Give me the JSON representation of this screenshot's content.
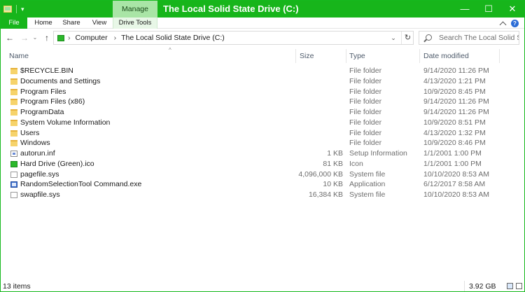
{
  "window": {
    "title": "The Local Solid State Drive (C:)",
    "contextual_tab": "Manage",
    "controls": {
      "minimize": "—",
      "maximize": "☐",
      "close": "✕"
    },
    "accent_color": "#17b51b"
  },
  "quick_access": {
    "separator": "|",
    "dropdown": "▾"
  },
  "ribbon": {
    "tabs": [
      {
        "label": "File"
      },
      {
        "label": "Home"
      },
      {
        "label": "Share"
      },
      {
        "label": "View"
      },
      {
        "label": "Drive Tools"
      }
    ],
    "collapse_icon": "chevron-up-icon",
    "help_icon": "?"
  },
  "nav": {
    "back": "←",
    "forward": "→",
    "recent": "⌄",
    "up": "↑"
  },
  "address": {
    "separator": "›",
    "crumbs": [
      "Computer",
      "The Local Solid State Drive (C:)"
    ],
    "dropdown": "⌄",
    "refresh": "↻"
  },
  "search": {
    "placeholder": "Search The Local Solid St..."
  },
  "columns": {
    "name": "Name",
    "size": "Size",
    "type": "Type",
    "date": "Date modified",
    "sort_indicator": "^"
  },
  "files": [
    {
      "name": "$RECYCLE.BIN",
      "size": "",
      "type": "File folder",
      "date": "9/14/2020 11:26 PM",
      "icon": "folder"
    },
    {
      "name": "Documents and Settings",
      "size": "",
      "type": "File folder",
      "date": "4/13/2020 1:21 PM",
      "icon": "folder"
    },
    {
      "name": "Program Files",
      "size": "",
      "type": "File folder",
      "date": "10/9/2020 8:45 PM",
      "icon": "folder"
    },
    {
      "name": "Program Files (x86)",
      "size": "",
      "type": "File folder",
      "date": "9/14/2020 11:26 PM",
      "icon": "folder"
    },
    {
      "name": "ProgramData",
      "size": "",
      "type": "File folder",
      "date": "9/14/2020 11:26 PM",
      "icon": "folder"
    },
    {
      "name": "System Volume Information",
      "size": "",
      "type": "File folder",
      "date": "10/9/2020 8:51 PM",
      "icon": "folder"
    },
    {
      "name": "Users",
      "size": "",
      "type": "File folder",
      "date": "4/13/2020 1:32 PM",
      "icon": "folder"
    },
    {
      "name": "Windows",
      "size": "",
      "type": "File folder",
      "date": "10/9/2020 8:46 PM",
      "icon": "folder"
    },
    {
      "name": "autorun.inf",
      "size": "1 KB",
      "type": "Setup Information",
      "date": "1/1/2001 1:00 PM",
      "icon": "inf"
    },
    {
      "name": "Hard Drive (Green).ico",
      "size": "81 KB",
      "type": "Icon",
      "date": "1/1/2001 1:00 PM",
      "icon": "drive"
    },
    {
      "name": "pagefile.sys",
      "size": "4,096,000 KB",
      "type": "System file",
      "date": "10/10/2020 8:53 AM",
      "icon": "file"
    },
    {
      "name": "RandomSelectionTool Command.exe",
      "size": "10 KB",
      "type": "Application",
      "date": "6/12/2017 8:58 AM",
      "icon": "exe"
    },
    {
      "name": "swapfile.sys",
      "size": "16,384 KB",
      "type": "System file",
      "date": "10/10/2020 8:53 AM",
      "icon": "file"
    }
  ],
  "status": {
    "item_count": "13 items",
    "free_space": "3.92 GB"
  }
}
